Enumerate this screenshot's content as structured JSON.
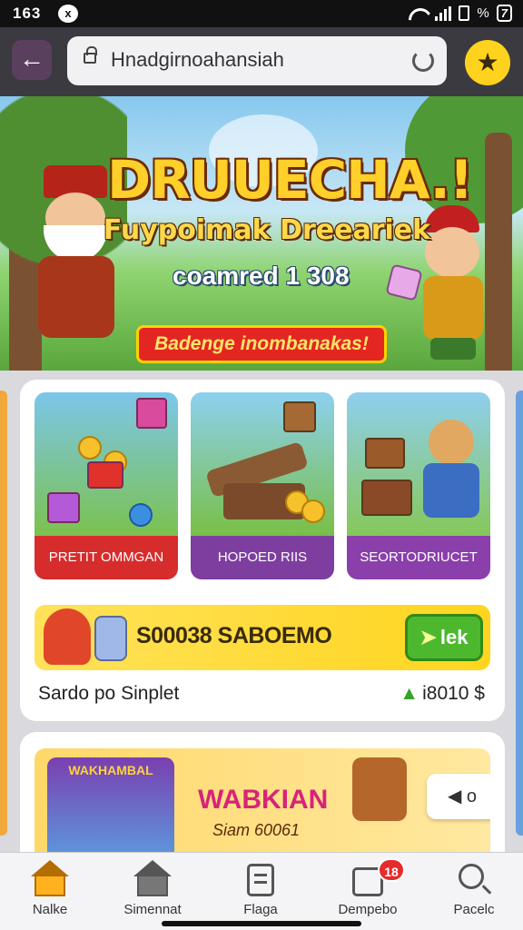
{
  "status_bar": {
    "time": "163",
    "notification_icon": "x",
    "battery_label": "%",
    "battery_value": "7"
  },
  "toolbar": {
    "back_icon": "arrow-left",
    "url": "Hnadgirnoahansiah",
    "favorite_icon": "star"
  },
  "banner": {
    "title": "DRUUECHA.!",
    "subtitle": "Fuypoimak Dreeariek",
    "line": "coamred 1 308",
    "cta": "Badenge inombanakas!"
  },
  "tiles": [
    {
      "label": "PRETIT OMMGAN"
    },
    {
      "label": "HOPOED RIIS"
    },
    {
      "label": "SEORTODRIUCET"
    }
  ],
  "promo": {
    "text": "S00038 SABOEMO",
    "button_label": "lek"
  },
  "balance": {
    "label": "Sardo po Sinplet",
    "value": "i8010 $"
  },
  "ad": {
    "thumb_title": "WAKHAMBAL",
    "title": "WABKIAN",
    "subtitle": "Siam 60061",
    "pill": "o"
  },
  "nav": {
    "items": [
      {
        "label": "Nalke",
        "icon": "home"
      },
      {
        "label": "Simennat",
        "icon": "home-outline"
      },
      {
        "label": "Flaga",
        "icon": "document"
      },
      {
        "label": "Dempebo",
        "icon": "board",
        "badge": "18"
      },
      {
        "label": "Pacelc",
        "icon": "search"
      }
    ]
  },
  "colors": {
    "accent_yellow": "#ffd21d",
    "nav_active": "#ffb21e",
    "promo_green": "#4db82e",
    "badge_red": "#e52b2b"
  }
}
